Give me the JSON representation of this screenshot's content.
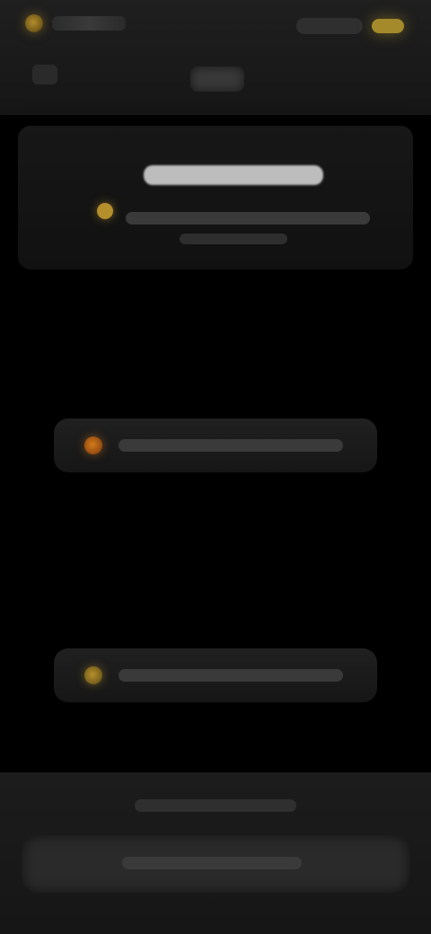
{
  "colors": {
    "background": "#000000",
    "accent_gold": "#b58f2b",
    "accent_orange": "#d07a1b"
  },
  "icons": {
    "logo": "logo-icon",
    "info": "info-icon",
    "button1": "dot-icon",
    "button2": "dot-icon"
  }
}
